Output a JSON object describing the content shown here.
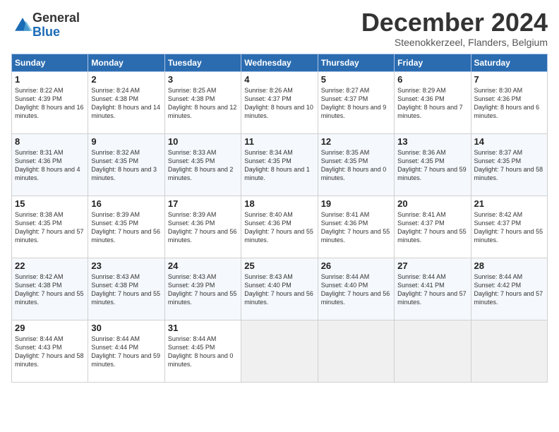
{
  "logo": {
    "general": "General",
    "blue": "Blue"
  },
  "header": {
    "month": "December 2024",
    "location": "Steenokkerzeel, Flanders, Belgium"
  },
  "days": [
    "Sunday",
    "Monday",
    "Tuesday",
    "Wednesday",
    "Thursday",
    "Friday",
    "Saturday"
  ],
  "weeks": [
    [
      {
        "day": 1,
        "sunrise": "8:22 AM",
        "sunset": "4:39 PM",
        "daylight": "8 hours and 16 minutes."
      },
      {
        "day": 2,
        "sunrise": "8:24 AM",
        "sunset": "4:38 PM",
        "daylight": "8 hours and 14 minutes."
      },
      {
        "day": 3,
        "sunrise": "8:25 AM",
        "sunset": "4:38 PM",
        "daylight": "8 hours and 12 minutes."
      },
      {
        "day": 4,
        "sunrise": "8:26 AM",
        "sunset": "4:37 PM",
        "daylight": "8 hours and 10 minutes."
      },
      {
        "day": 5,
        "sunrise": "8:27 AM",
        "sunset": "4:37 PM",
        "daylight": "8 hours and 9 minutes."
      },
      {
        "day": 6,
        "sunrise": "8:29 AM",
        "sunset": "4:36 PM",
        "daylight": "8 hours and 7 minutes."
      },
      {
        "day": 7,
        "sunrise": "8:30 AM",
        "sunset": "4:36 PM",
        "daylight": "8 hours and 6 minutes."
      }
    ],
    [
      {
        "day": 8,
        "sunrise": "8:31 AM",
        "sunset": "4:36 PM",
        "daylight": "8 hours and 4 minutes."
      },
      {
        "day": 9,
        "sunrise": "8:32 AM",
        "sunset": "4:35 PM",
        "daylight": "8 hours and 3 minutes."
      },
      {
        "day": 10,
        "sunrise": "8:33 AM",
        "sunset": "4:35 PM",
        "daylight": "8 hours and 2 minutes."
      },
      {
        "day": 11,
        "sunrise": "8:34 AM",
        "sunset": "4:35 PM",
        "daylight": "8 hours and 1 minute."
      },
      {
        "day": 12,
        "sunrise": "8:35 AM",
        "sunset": "4:35 PM",
        "daylight": "8 hours and 0 minutes."
      },
      {
        "day": 13,
        "sunrise": "8:36 AM",
        "sunset": "4:35 PM",
        "daylight": "7 hours and 59 minutes."
      },
      {
        "day": 14,
        "sunrise": "8:37 AM",
        "sunset": "4:35 PM",
        "daylight": "7 hours and 58 minutes."
      }
    ],
    [
      {
        "day": 15,
        "sunrise": "8:38 AM",
        "sunset": "4:35 PM",
        "daylight": "7 hours and 57 minutes."
      },
      {
        "day": 16,
        "sunrise": "8:39 AM",
        "sunset": "4:35 PM",
        "daylight": "7 hours and 56 minutes."
      },
      {
        "day": 17,
        "sunrise": "8:39 AM",
        "sunset": "4:36 PM",
        "daylight": "7 hours and 56 minutes."
      },
      {
        "day": 18,
        "sunrise": "8:40 AM",
        "sunset": "4:36 PM",
        "daylight": "7 hours and 55 minutes."
      },
      {
        "day": 19,
        "sunrise": "8:41 AM",
        "sunset": "4:36 PM",
        "daylight": "7 hours and 55 minutes."
      },
      {
        "day": 20,
        "sunrise": "8:41 AM",
        "sunset": "4:37 PM",
        "daylight": "7 hours and 55 minutes."
      },
      {
        "day": 21,
        "sunrise": "8:42 AM",
        "sunset": "4:37 PM",
        "daylight": "7 hours and 55 minutes."
      }
    ],
    [
      {
        "day": 22,
        "sunrise": "8:42 AM",
        "sunset": "4:38 PM",
        "daylight": "7 hours and 55 minutes."
      },
      {
        "day": 23,
        "sunrise": "8:43 AM",
        "sunset": "4:38 PM",
        "daylight": "7 hours and 55 minutes."
      },
      {
        "day": 24,
        "sunrise": "8:43 AM",
        "sunset": "4:39 PM",
        "daylight": "7 hours and 55 minutes."
      },
      {
        "day": 25,
        "sunrise": "8:43 AM",
        "sunset": "4:40 PM",
        "daylight": "7 hours and 56 minutes."
      },
      {
        "day": 26,
        "sunrise": "8:44 AM",
        "sunset": "4:40 PM",
        "daylight": "7 hours and 56 minutes."
      },
      {
        "day": 27,
        "sunrise": "8:44 AM",
        "sunset": "4:41 PM",
        "daylight": "7 hours and 57 minutes."
      },
      {
        "day": 28,
        "sunrise": "8:44 AM",
        "sunset": "4:42 PM",
        "daylight": "7 hours and 57 minutes."
      }
    ],
    [
      {
        "day": 29,
        "sunrise": "8:44 AM",
        "sunset": "4:43 PM",
        "daylight": "7 hours and 58 minutes."
      },
      {
        "day": 30,
        "sunrise": "8:44 AM",
        "sunset": "4:44 PM",
        "daylight": "7 hours and 59 minutes."
      },
      {
        "day": 31,
        "sunrise": "8:44 AM",
        "sunset": "4:45 PM",
        "daylight": "8 hours and 0 minutes."
      },
      null,
      null,
      null,
      null
    ]
  ]
}
